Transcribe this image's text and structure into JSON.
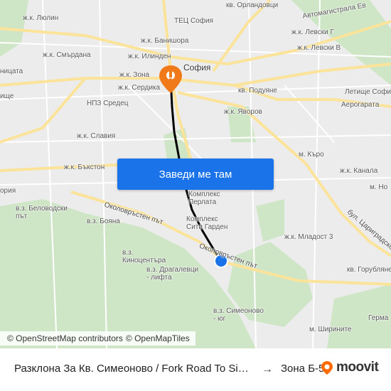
{
  "map": {
    "labels": {
      "lyulin": "ж.к. Люлин",
      "orlandovtsi": "кв. Орландовци",
      "avtomagistrala": "Автомагистрала Ев",
      "tets": "ТЕЦ София",
      "banishora": "ж.к. Банишора",
      "levski_g": "ж.к. Левски Г",
      "smardana": "ж.к. Смърдана",
      "ilinden": "ж.к. Илинден",
      "levski_v": "ж.к. Левски В",
      "nitsata": "ницата",
      "zona": "ж.к. Зона",
      "sofia": "София",
      "serdika": "ж.к. Сердика",
      "letishte_sofia": "Летище Софи",
      "ishte": "ище",
      "podunye": "кв. Подуяне",
      "aerogarata": "Аерогарата",
      "npz_sredets": "НПЗ Средец",
      "yavorov": "ж.к. Яворов",
      "slaviya": "ж.к. Славия",
      "m_kuro": "м. Къро",
      "bakston": "ж.к. Бъкстон",
      "kanala": "ж.к. Канала",
      "m_no": "м. Но",
      "oriya": "ория",
      "kompleks_perlata": "Комплекс\nПерлата",
      "belovodski": "в.з. Беловодски\nпът",
      "boyana": "в.з. Бояна",
      "okolovrasten_left": "Околовръстен път",
      "kompleks_siti": "Комплекс\nСити Гарден",
      "tsarigradsko": "бул. Цариградско",
      "mladost3": "ж.к. Младост 3",
      "kinotsentara": "в.з.\nКиноцентъра",
      "okolovrasten_right": "Околовръстен път",
      "dragalevtsi": "в.з. Драгалевци\n- лифта",
      "gorublyane": "кв. Горубляне",
      "simeonovo": "в.з. Симеоново\n- юг",
      "germa": "Герма",
      "shirinite": "м. Ширините"
    },
    "cta_label": "Заведи ме там",
    "attribution": {
      "osm_contrib": "© OpenStreetMapContributors",
      "osm": "© OpenMapTiles"
    }
  },
  "footer": {
    "route": "Разклона За Кв. Симеоново / Fork Road To Simeonovo",
    "arrow": "→",
    "destination": "Зона Б-5",
    "brand": "moovit",
    "brand_color": "#ff6a00"
  },
  "colors": {
    "route_line": "#000000",
    "start_marker": "#1a73e8",
    "dest_marker": "#f07a1a",
    "cta_bg": "#1a73e8",
    "park": "#cfe6c6",
    "major_road": "#fbe39a"
  }
}
